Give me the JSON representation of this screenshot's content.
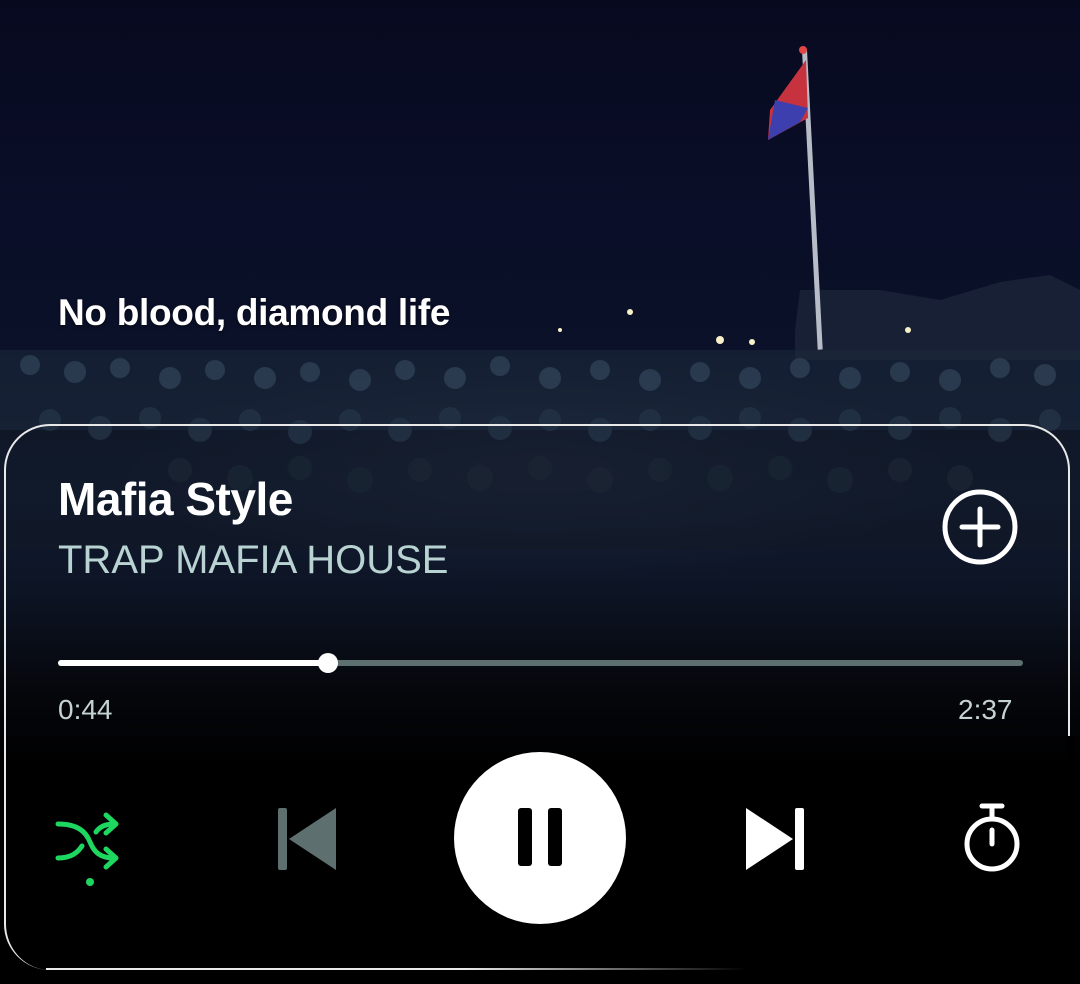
{
  "lyric": {
    "current_line": "No blood, diamond life"
  },
  "track": {
    "title": "Mafia Style",
    "artist": "TRAP MAFIA HOUSE"
  },
  "progress": {
    "elapsed": "0:44",
    "duration": "2:37",
    "fraction": 0.28
  },
  "controls": {
    "shuffle_active": true,
    "playing": true
  },
  "colors": {
    "accent_green": "#1ed760",
    "text_primary": "#ffffff",
    "text_secondary": "#b9d3d3",
    "disabled_icon": "#5e6f6f"
  },
  "icons": {
    "add": "plus-circle-icon",
    "shuffle": "shuffle-icon",
    "previous": "skip-previous-icon",
    "pause": "pause-icon",
    "next": "skip-next-icon",
    "timer": "stopwatch-icon"
  }
}
